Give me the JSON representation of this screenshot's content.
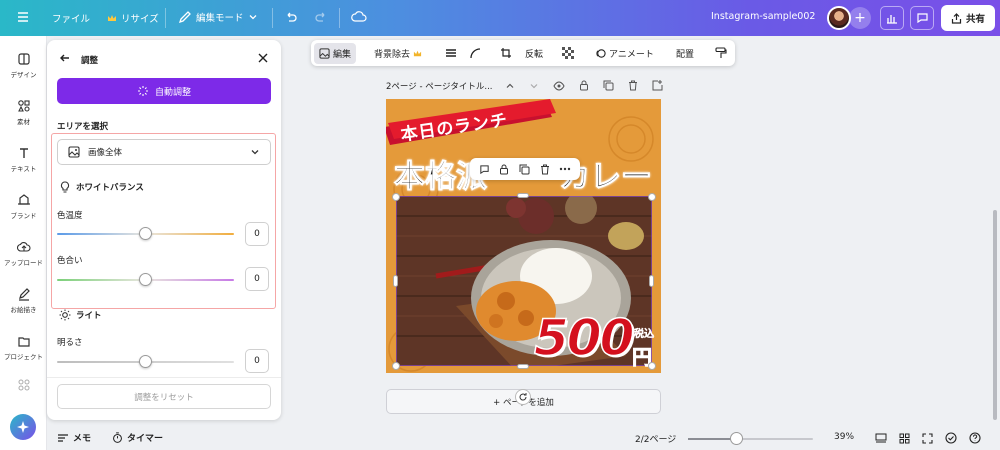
{
  "topbar": {
    "menu_icon": "hamburger-icon",
    "file": "ファイル",
    "resize": "リサイズ",
    "edit_mode": "編集モード",
    "doc_title": "Instagram-sample002",
    "share": "共有"
  },
  "rail": [
    {
      "label": "デザイン",
      "icon": "design-icon"
    },
    {
      "label": "素材",
      "icon": "elements-icon"
    },
    {
      "label": "テキスト",
      "icon": "text-icon"
    },
    {
      "label": "ブランド",
      "icon": "brand-icon"
    },
    {
      "label": "アップロード",
      "icon": "upload-icon"
    },
    {
      "label": "お絵描き",
      "icon": "draw-icon"
    },
    {
      "label": "プロジェクト",
      "icon": "folder-icon"
    }
  ],
  "panel": {
    "title": "調整",
    "auto_adjust": "自動調整",
    "area_label": "エリアを選択",
    "area_value": "画像全体",
    "white_balance": "ホワイトバランス",
    "temperature_label": "色温度",
    "temperature_value": "0",
    "tint_label": "色合い",
    "tint_value": "0",
    "light": "ライト",
    "brightness_label": "明るさ",
    "brightness_value": "0",
    "reset": "調整をリセット",
    "temperature_level": 0.5,
    "tint_level": 0.5,
    "brightness_level": 0.5
  },
  "toolbar": {
    "edit": "編集",
    "bg_remove": "背景除去",
    "flip": "反転",
    "animate": "アニメート",
    "position": "配置"
  },
  "page_header": {
    "title": "2ページ - ページタイトル..."
  },
  "canvas": {
    "banner_text": "本日のランチ",
    "headline": "本格派",
    "headline_tail": "カレー",
    "price": "500",
    "tax_label": "税込",
    "yen": "円",
    "add_page": "+ ページを追加"
  },
  "bottombar": {
    "notes": "メモ",
    "timer": "タイマー",
    "page_count": "2/2ページ",
    "zoom": "39%",
    "zoom_level": 0.39
  }
}
